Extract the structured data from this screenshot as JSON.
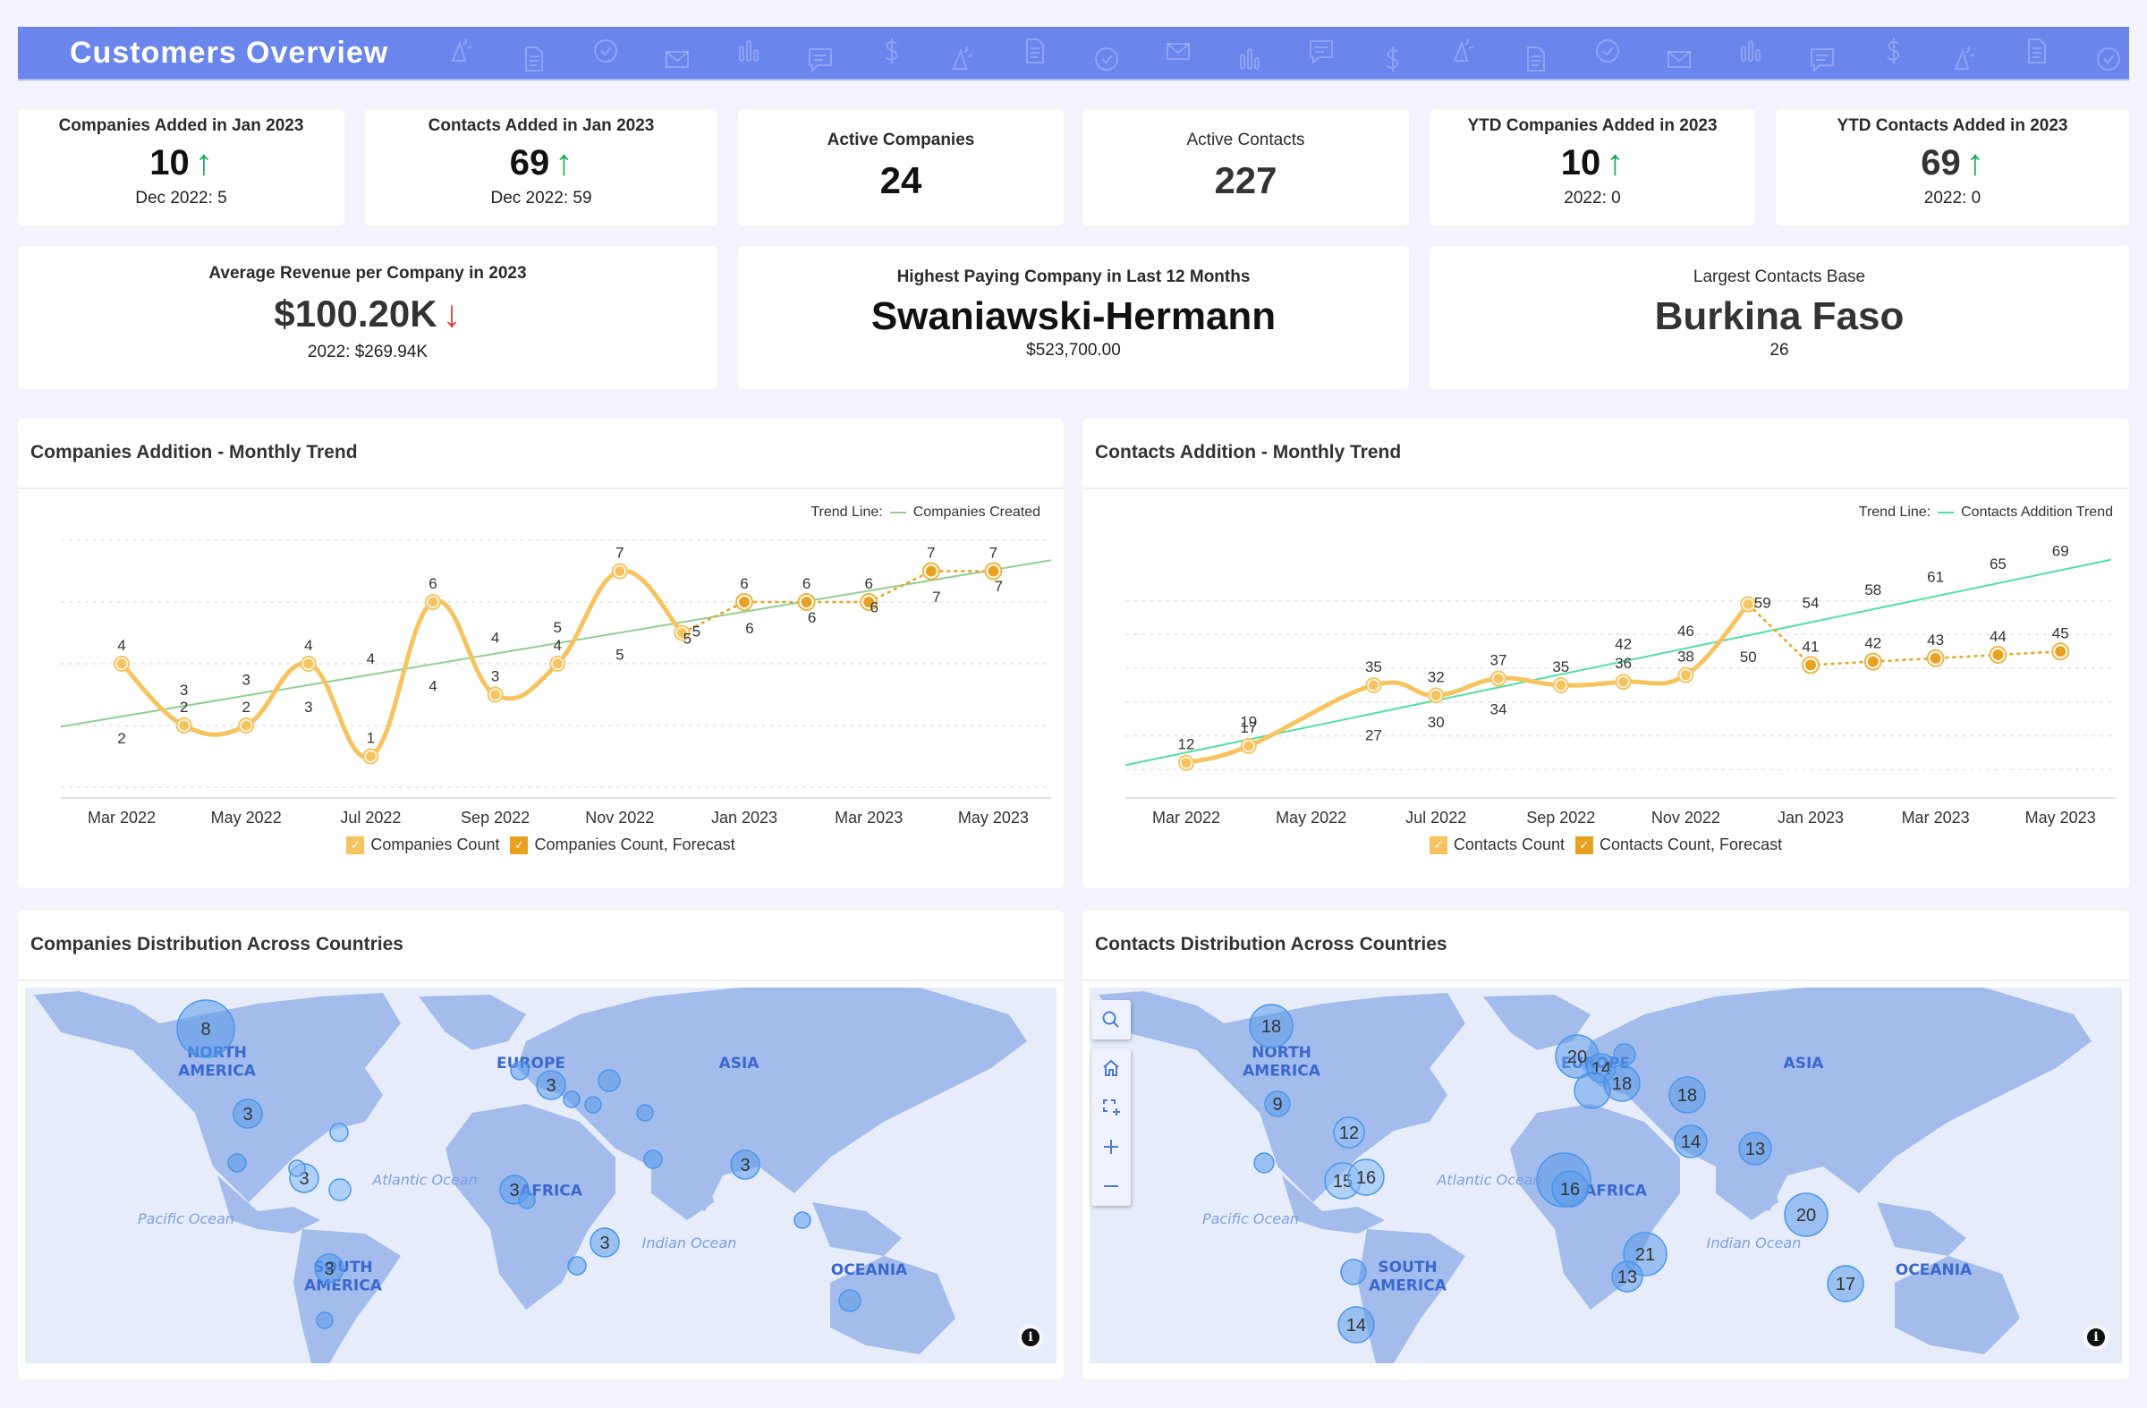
{
  "header": {
    "title": "Customers Overview"
  },
  "kpis_row1": [
    {
      "label": "Companies Added in Jan 2023",
      "value": "10",
      "trend": "up",
      "sub": "Dec 2022: 5"
    },
    {
      "label": "Contacts Added in Jan 2023",
      "value": "69",
      "trend": "up",
      "sub": "Dec 2022: 59"
    },
    {
      "label": "Active Companies",
      "value": "24"
    },
    {
      "label": "Active Contacts",
      "value": "227"
    },
    {
      "label": "YTD Companies Added in 2023",
      "value": "10",
      "trend": "up",
      "sub": "2022: 0"
    },
    {
      "label": "YTD Contacts Added in 2023",
      "value": "69",
      "trend": "up",
      "sub": "2022: 0"
    }
  ],
  "kpis_row2": [
    {
      "label": "Average Revenue per Company in 2023",
      "value": "$100.20K",
      "trend": "down",
      "sub": "2022: $269.94K"
    },
    {
      "label": "Highest Paying Company in Last 12 Months",
      "value": "Swaniawski-Hermann",
      "sub": "$523,700.00"
    },
    {
      "label": "Largest Contacts Base",
      "value": "Burkina Faso",
      "sub": "26"
    }
  ],
  "arrows": {
    "up": "↑",
    "down": "↓"
  },
  "colors": {
    "banner": "#6a85ec",
    "series": "#f7c35f",
    "forecast": "#e9a21f",
    "companies_trend": "#8fd08f",
    "contacts_trend": "#4fe0a0",
    "bubble": "#5b9bea",
    "land": "#a3bcec",
    "ocean": "#e6ecfa",
    "up": "#18a957",
    "down": "#e23a3a"
  },
  "chart_data": [
    {
      "type": "line",
      "title": "Companies Addition - Monthly Trend",
      "x": [
        "Mar 2022",
        "Apr 2022",
        "May 2022",
        "Jun 2022",
        "Jul 2022",
        "Aug 2022",
        "Sep 2022",
        "Oct 2022",
        "Nov 2022",
        "Dec 2022",
        "Jan 2023",
        "Feb 2023",
        "Mar 2023",
        "Apr 2023",
        "May 2023"
      ],
      "x_tick_labels": [
        "Mar 2022",
        "May 2022",
        "Jul 2022",
        "Sep 2022",
        "Nov 2022",
        "Jan 2023",
        "Mar 2023",
        "May 2023"
      ],
      "ylim": [
        0,
        8
      ],
      "grid": true,
      "trend_legend_label": "Trend Line:",
      "series": [
        {
          "name": "Companies Count",
          "values": [
            4,
            2,
            2,
            4,
            1,
            6,
            3,
            4,
            7,
            5,
            null,
            null,
            null,
            null,
            null
          ]
        },
        {
          "name": "Companies Count, Forecast",
          "values": [
            null,
            null,
            null,
            null,
            null,
            null,
            null,
            null,
            null,
            5,
            6,
            6,
            6,
            7,
            7
          ]
        },
        {
          "name": "Companies Created",
          "kind": "trend",
          "values": [
            2,
            3,
            3,
            3,
            4,
            4,
            4,
            5,
            5,
            5,
            6,
            6,
            6,
            7,
            7
          ]
        }
      ],
      "legend": [
        "Companies Count",
        "Companies Count, Forecast"
      ],
      "legend_position": "bottom"
    },
    {
      "type": "line",
      "title": "Contacts Addition - Monthly Trend",
      "x": [
        "Mar 2022",
        "Apr 2022",
        "May 2022",
        "Jun 2022",
        "Jul 2022",
        "Aug 2022",
        "Sep 2022",
        "Oct 2022",
        "Nov 2022",
        "Dec 2022",
        "Jan 2023",
        "Feb 2023",
        "Mar 2023",
        "Apr 2023",
        "May 2023"
      ],
      "x_tick_labels": [
        "Mar 2022",
        "May 2022",
        "Jul 2022",
        "Sep 2022",
        "Nov 2022",
        "Jan 2023",
        "Mar 2023",
        "May 2023"
      ],
      "ylim": [
        0,
        70
      ],
      "grid": true,
      "trend_legend_label": "Trend Line:",
      "series": [
        {
          "name": "Contacts Count",
          "values": [
            12,
            17,
            null,
            35,
            32,
            37,
            35,
            36,
            38,
            59,
            null,
            null,
            null,
            null,
            null
          ]
        },
        {
          "name": "Contacts Count, Forecast",
          "values": [
            null,
            null,
            null,
            null,
            null,
            null,
            null,
            null,
            null,
            59,
            41,
            42,
            43,
            44,
            45
          ]
        },
        {
          "name": "Contacts Addition Trend",
          "kind": "trend",
          "values": [
            null,
            19,
            null,
            27,
            30,
            34,
            null,
            42,
            46,
            50,
            54,
            58,
            61,
            65,
            69
          ]
        }
      ],
      "legend": [
        "Contacts Count",
        "Contacts Count, Forecast"
      ],
      "legend_position": "bottom"
    }
  ],
  "maps": [
    {
      "title": "Companies Distribution Across Countries",
      "labels": {
        "na": "NORTH\nAMERICA",
        "sa": "SOUTH\nAMERICA",
        "eu": "EUROPE",
        "af": "AFRICA",
        "as": "ASIA",
        "oc": "OCEANIA",
        "atlantic": "Atlantic Ocean",
        "pacific": "Pacific Ocean",
        "indian": "Indian Ocean"
      },
      "bubbles": [
        {
          "region": "Canada",
          "value": "8"
        },
        {
          "region": "United States",
          "value": "3"
        },
        {
          "region": "Atlantic",
          "value": ""
        },
        {
          "region": "Mexico",
          "value": ""
        },
        {
          "region": "Caribbean",
          "value": "3"
        },
        {
          "region": "Caribbean East",
          "value": ""
        },
        {
          "region": "Cuba",
          "value": ""
        },
        {
          "region": "South America",
          "value": "3"
        },
        {
          "region": "Argentina",
          "value": ""
        },
        {
          "region": "Western Europe",
          "value": ""
        },
        {
          "region": "Central Europe",
          "value": "3"
        },
        {
          "region": "Balkans",
          "value": ""
        },
        {
          "region": "Ukraine",
          "value": ""
        },
        {
          "region": "Turkey",
          "value": ""
        },
        {
          "region": "Caspian",
          "value": ""
        },
        {
          "region": "Arabia",
          "value": ""
        },
        {
          "region": "West Africa",
          "value": "3"
        },
        {
          "region": "Nigeria",
          "value": ""
        },
        {
          "region": "East Africa",
          "value": "3"
        },
        {
          "region": "Angola",
          "value": ""
        },
        {
          "region": "South Asia",
          "value": "3"
        },
        {
          "region": "Borneo",
          "value": ""
        },
        {
          "region": "Australia",
          "value": ""
        }
      ]
    },
    {
      "title": "Contacts Distribution Across Countries",
      "labels": {
        "na": "NORTH\nAMERICA",
        "sa": "SOUTH\nAMERICA",
        "eu": "EUROPE",
        "af": "AFRICA",
        "as": "ASIA",
        "oc": "OCEANIA",
        "atlantic": "Atlantic Ocean",
        "pacific": "Pacific Ocean",
        "indian": "Indian Ocean"
      },
      "bubbles": [
        {
          "region": "Canada",
          "value": "18"
        },
        {
          "region": "United States",
          "value": "9"
        },
        {
          "region": "Atlantic",
          "value": "12"
        },
        {
          "region": "Mexico",
          "value": ""
        },
        {
          "region": "Central America",
          "value": "15"
        },
        {
          "region": "Venezuela",
          "value": "16"
        },
        {
          "region": "South America North",
          "value": ""
        },
        {
          "region": "Argentina",
          "value": "14"
        },
        {
          "region": "Western Europe",
          "value": "20"
        },
        {
          "region": "Central Europe",
          "value": "14"
        },
        {
          "region": "Northern Europe",
          "value": ""
        },
        {
          "region": "Italy",
          "value": ""
        },
        {
          "region": "Balkans",
          "value": "18"
        },
        {
          "region": "Caucasus",
          "value": "18"
        },
        {
          "region": "Arabia",
          "value": "14"
        },
        {
          "region": "West Africa Large",
          "value": ""
        },
        {
          "region": "West Africa",
          "value": "16"
        },
        {
          "region": "East Africa",
          "value": "21"
        },
        {
          "region": "Angola",
          "value": "13"
        },
        {
          "region": "South Asia",
          "value": "13"
        },
        {
          "region": "Borneo",
          "value": "20"
        },
        {
          "region": "Australia",
          "value": "17"
        }
      ],
      "controls": [
        "search-icon",
        "home-icon",
        "select-zoom-icon",
        "zoom-in-icon",
        "zoom-out-icon"
      ]
    }
  ],
  "info_icon": "i"
}
